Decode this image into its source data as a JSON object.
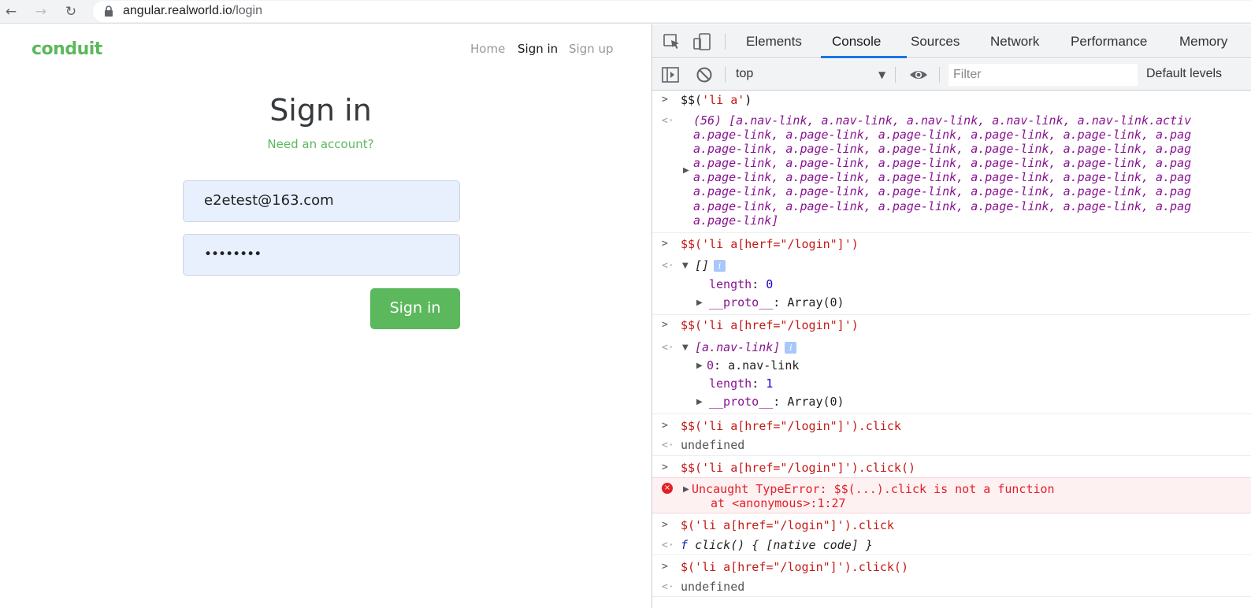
{
  "browser": {
    "back_icon": "←",
    "forward_icon": "→",
    "reload_icon": "↻",
    "url_host": "angular.realworld.io",
    "url_path": "/login"
  },
  "app": {
    "brand": "conduit",
    "nav": [
      "Home",
      "Sign in",
      "Sign up"
    ],
    "title": "Sign in",
    "subtitle": "Need an account?",
    "email_value": "e2etest@163.com",
    "password_value": "••••••••",
    "submit_label": "Sign in",
    "accent_color": "#5cb85c"
  },
  "devtools": {
    "tabs": [
      "Elements",
      "Console",
      "Sources",
      "Network",
      "Performance",
      "Memory"
    ],
    "active_tab": "Console",
    "context": "top",
    "filter_placeholder": "Filter",
    "levels": "Default levels",
    "console": {
      "cmd1": "$$('li a')",
      "res1_lines": [
        "(56) [a.nav-link, a.nav-link, a.nav-link, a.nav-link, a.nav-link.activ",
        "a.page-link, a.page-link, a.page-link, a.page-link, a.page-link, a.pag",
        "a.page-link, a.page-link, a.page-link, a.page-link, a.page-link, a.pag",
        "a.page-link, a.page-link, a.page-link, a.page-link, a.page-link, a.pag",
        "a.page-link, a.page-link, a.page-link, a.page-link, a.page-link, a.pag",
        "a.page-link, a.page-link, a.page-link, a.page-link, a.page-link, a.pag",
        "a.page-link, a.page-link, a.page-link, a.page-link, a.page-link, a.pag",
        "a.page-link]"
      ],
      "cmd2": "$$('li a[herf=\"/login\"]')",
      "res2_head": "[]",
      "res2_length_key": "length",
      "res2_length_val": "0",
      "proto_key": "__proto__",
      "proto_val": "Array(0)",
      "cmd3": "$$('li a[href=\"/login\"]')",
      "res3_head": "[a.nav-link]",
      "res3_item_key": "0",
      "res3_item_val": "a.nav-link",
      "res3_length_val": "1",
      "cmd4": "$$('li a[href=\"/login\"]').click",
      "res4": "undefined",
      "cmd5": "$$('li a[href=\"/login\"]').click()",
      "err5_line1": "Uncaught TypeError: $$(...).click is not a function",
      "err5_line2": "at <anonymous>:1:27",
      "cmd6": "$('li a[href=\"/login\"]').click",
      "res6_f": "f",
      "res6_rest": "click() { [native code] }",
      "cmd7": "$('li a[href=\"/login\"]').click()",
      "res7": "undefined",
      "info_glyph": "i",
      "error_glyph": "×"
    }
  }
}
